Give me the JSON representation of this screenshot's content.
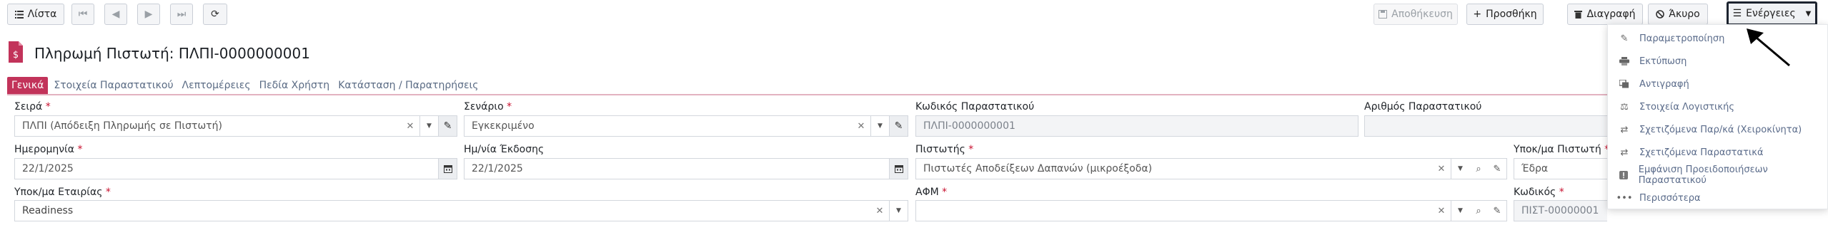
{
  "toolbar": {
    "list_label": "Λίστα",
    "save_label": "Αποθήκευση",
    "add_label": "Προσθήκη",
    "delete_label": "Διαγραφή",
    "cancel_label": "Άκυρο",
    "actions_label": "Ενέργειες"
  },
  "page": {
    "title": "Πληρωμή Πιστωτή: ΠΛΠΙ-0000000001"
  },
  "tabs": [
    {
      "label": "Γενικά",
      "active": true
    },
    {
      "label": "Στοιχεία Παραστατικού"
    },
    {
      "label": "Λεπτομέρειες"
    },
    {
      "label": "Πεδία Χρήστη"
    },
    {
      "label": "Κατάσταση / Παρατηρήσεις"
    }
  ],
  "form": {
    "series": {
      "label": "Σειρά",
      "value": "ΠΛΠΙ (Απόδειξη Πληρωμής σε Πιστωτή)"
    },
    "scenario": {
      "label": "Σενάριο",
      "value": "Εγκεκριμένο"
    },
    "doc_code": {
      "label": "Κωδικός Παραστατικού",
      "value": "ΠΛΠΙ-0000000001"
    },
    "doc_number": {
      "label": "Αριθμός Παραστατικού",
      "value": ""
    },
    "date": {
      "label": "Ημερομηνία",
      "value": "22/1/2025"
    },
    "issue_date": {
      "label": "Ημ/νία Έκδοσης",
      "value": "22/1/2025"
    },
    "creditor": {
      "label": "Πιστωτής",
      "value": "Πιστωτές Αποδείξεων Δαπανών (μικροέξοδα)"
    },
    "creditor_branch": {
      "label": "Υποκ/μα Πιστωτή",
      "value": "Έδρα"
    },
    "company_branch": {
      "label": "Υποκ/μα Εταιρίας",
      "value": "Readiness"
    },
    "afm": {
      "label": "ΑΦΜ",
      "value": ""
    },
    "code": {
      "label": "Κωδικός",
      "value": "ΠΙΣΤ-00000001"
    }
  },
  "menu": [
    {
      "label": "Παραμετροποίηση",
      "icon": "edit-icon"
    },
    {
      "label": "Εκτύπωση",
      "icon": "print-icon"
    },
    {
      "label": "Αντιγραφή",
      "icon": "copy-icon"
    },
    {
      "label": "Στοιχεία Λογιστικής",
      "icon": "scale-icon"
    },
    {
      "label": "Σχετιζόμενα Παρ/κά (Χειροκίνητα)",
      "icon": "exchange-icon"
    },
    {
      "label": "Σχετιζόμενα Παραστατικά",
      "icon": "exchange-icon"
    },
    {
      "label": "Εμφάνιση Προειδοποιήσεων Παραστατικού",
      "icon": "warning-icon"
    },
    {
      "label": "Περισσότερα",
      "icon": "more-icon"
    }
  ],
  "colors": {
    "accent": "#c2335a",
    "link": "#5a6b84"
  }
}
